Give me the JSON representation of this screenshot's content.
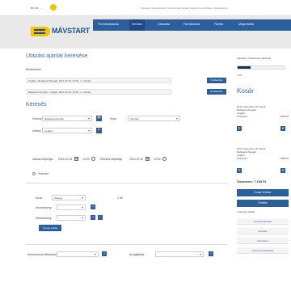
{
  "topbar": {
    "lang": "en  cs  ...",
    "links": "Belépés / Regisztráció  |  Felhasználói adatok  |  Ajánlat nyomtatása  |  Kijelentkezés"
  },
  "header": {
    "logo_text": "MÁVSTART",
    "tabs": [
      "Termékválasztás",
      "Keresés",
      "Választás",
      "Fizetőeszköz",
      "Fizetés",
      "Megerősítés"
    ]
  },
  "offer_search": {
    "title": "Utazási ajánlat keresése",
    "subtitle": "Budavasvári",
    "rows": [
      {
        "text": "Cegléd - Budapest-Nyugati, 2013.12.18. 10:39 - 2. osztály",
        "btn": "Kiválasztás"
      },
      {
        "text": "Budapest-Nyugati - Cegléd, 2013.12.30. 10:39 - 2. osztály",
        "btn": "Kiválasztás"
      }
    ]
  },
  "search": {
    "title": "Keresés",
    "from_label": "Honnan",
    "from_value": "Budapest-Nyugati",
    "to_label": "Hova",
    "to_value": "Szolnok",
    "via_label": "Útirány",
    "via_value": "Cegléd",
    "depart_label": "Utazás időpontja",
    "depart_date": "2013.12.18.",
    "depart_time": "10:39",
    "return_label": "Érkezés időpontja",
    "return_date": "2013.12.30.",
    "return_time": "10:39",
    "return_opt": "Visszaút",
    "class_label": "Kocsi",
    "class_value": "Pótjegy",
    "count_value": "1 db",
    "disc1_label": "Kedvezmény",
    "disc2_label": "Kedvezmény",
    "submit": "Új jegy adatai"
  },
  "bottom": {
    "left_label": "Kedvezmény felhasználó",
    "right_label": "Szolgáltatás"
  },
  "side": {
    "top_label": "Időtartam: kiválasztott utazások",
    "bar_value": "1:40",
    "bar_fraction": 0.28,
    "cart_title": "Kosár",
    "items": [
      {
        "date": "2013. december 18. Szerd.",
        "route": "Budapest-Nyugati",
        "to": "Cegléd",
        "kind": "Összesen",
        "price": "2.510 Ft"
      },
      {
        "date": "2013. december 18. Szerd.",
        "route": "Budapest-Nyugati",
        "to": "Cegléd",
        "kind": "Összesen",
        "price": "3.580 Ft"
      }
    ],
    "total_label": "Összesen:",
    "total_value": "7.153 Ft",
    "btn_continue": "Kosár ürítése",
    "btn_pay": "Fizetés",
    "menu_title": "Jelenlegi oldalak",
    "menu": [
      "Termékválasztás",
      "Keresés",
      "Információ",
      "Kedvező utazóknak"
    ]
  },
  "colors": {
    "brand_blue": "#2c5e9c",
    "brand_yellow": "#f2c200",
    "title_blue": "#3b6aa8"
  }
}
